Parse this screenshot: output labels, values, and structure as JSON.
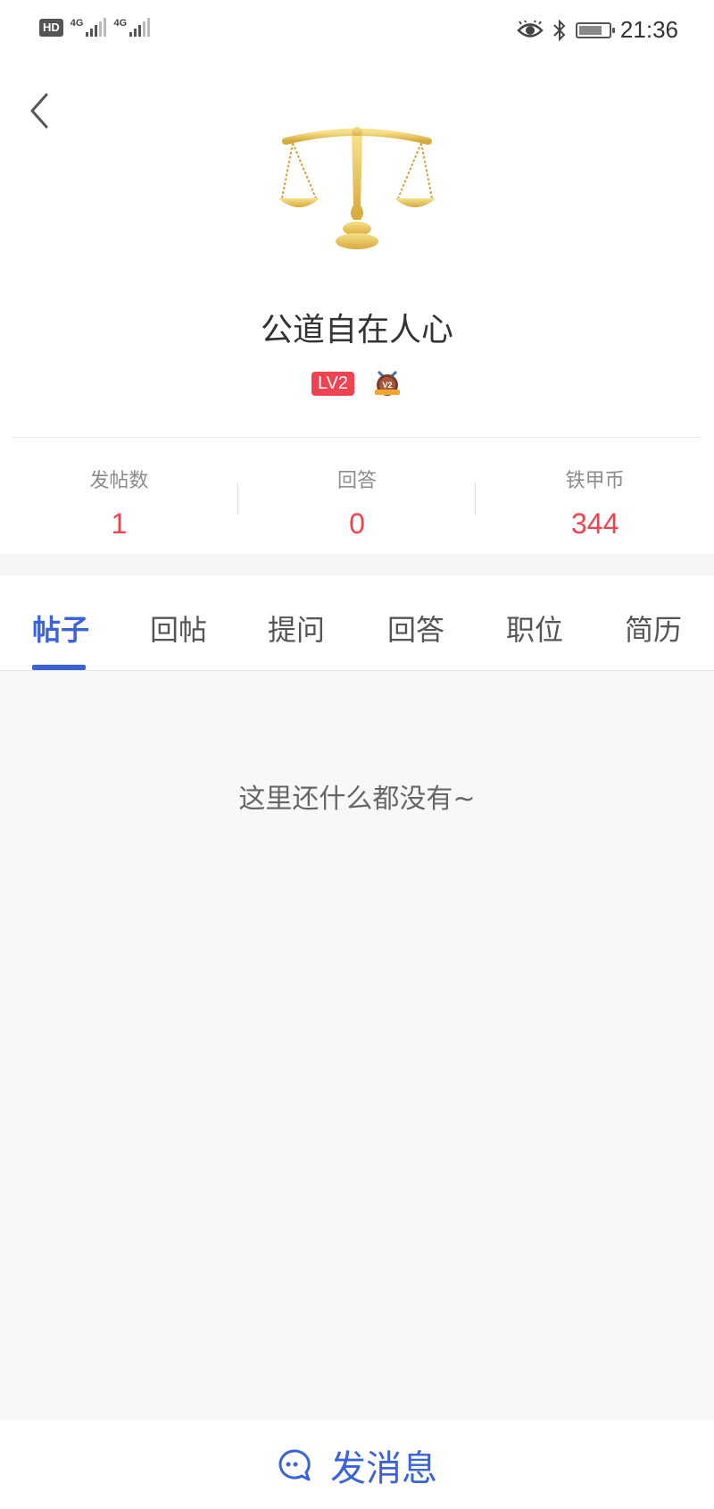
{
  "status_bar": {
    "hd_label": "HD",
    "network1_label": "4G",
    "network2_label": "4G",
    "time": "21:36",
    "icons": [
      "eye-icon",
      "bluetooth-icon",
      "battery-icon"
    ]
  },
  "header": {
    "back_icon": "chevron-left-icon"
  },
  "profile": {
    "avatar_icon": "justice-scale-icon",
    "name": "公道自在人心",
    "level_badge": "LV2",
    "medal_icon": "v2-medal-icon"
  },
  "stats": [
    {
      "label": "发帖数",
      "value": "1"
    },
    {
      "label": "回答",
      "value": "0"
    },
    {
      "label": "铁甲币",
      "value": "344"
    }
  ],
  "tabs": [
    {
      "label": "帖子",
      "active": true
    },
    {
      "label": "回帖",
      "active": false
    },
    {
      "label": "提问",
      "active": false
    },
    {
      "label": "回答",
      "active": false
    },
    {
      "label": "职位",
      "active": false
    },
    {
      "label": "简历",
      "active": false
    }
  ],
  "content": {
    "empty_message": "这里还什么都没有~"
  },
  "footer": {
    "icon": "chat-bubble-icon",
    "label": "发消息"
  },
  "colors": {
    "accent": "#3a63d8",
    "stat_value": "#f0424f",
    "level_badge_bg": "#f0424f",
    "content_bg": "#f8f8f8"
  }
}
